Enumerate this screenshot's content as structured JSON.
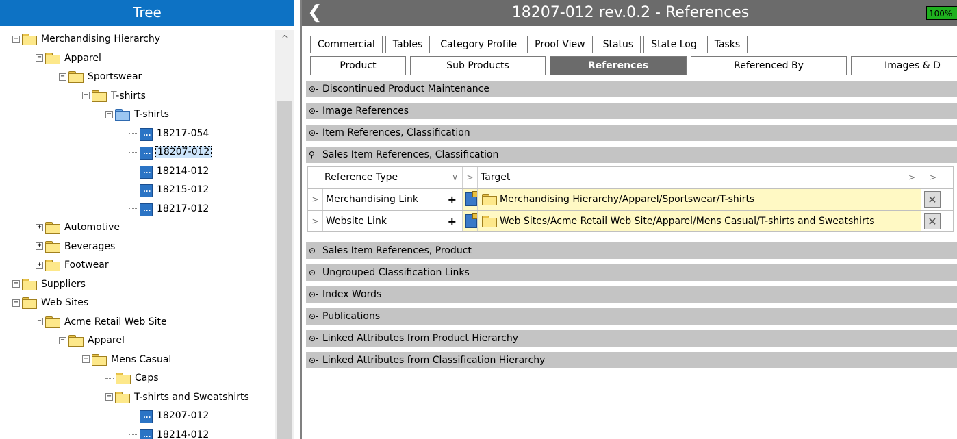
{
  "tree": {
    "header": "Tree",
    "items": [
      {
        "label": "Merchandising Hierarchy",
        "level": 0,
        "expander": "−",
        "icon": "folder"
      },
      {
        "label": "Apparel",
        "level": 1,
        "expander": "−",
        "icon": "folder"
      },
      {
        "label": "Sportswear",
        "level": 2,
        "expander": "−",
        "icon": "folder"
      },
      {
        "label": "T-shirts",
        "level": 3,
        "expander": "−",
        "icon": "folder"
      },
      {
        "label": "T-shirts",
        "level": 4,
        "expander": "−",
        "icon": "folder-blue"
      },
      {
        "label": "18217-054",
        "level": 5,
        "expander": "",
        "icon": "product"
      },
      {
        "label": "18207-012",
        "level": 5,
        "expander": "",
        "icon": "product",
        "selected": true
      },
      {
        "label": "18214-012",
        "level": 5,
        "expander": "",
        "icon": "product"
      },
      {
        "label": "18215-012",
        "level": 5,
        "expander": "",
        "icon": "product"
      },
      {
        "label": "18217-012",
        "level": 5,
        "expander": "",
        "icon": "product"
      },
      {
        "label": "Automotive",
        "level": 1,
        "expander": "+",
        "icon": "folder"
      },
      {
        "label": "Beverages",
        "level": 1,
        "expander": "+",
        "icon": "folder"
      },
      {
        "label": "Footwear",
        "level": 1,
        "expander": "+",
        "icon": "folder"
      },
      {
        "label": "Suppliers",
        "level": 0,
        "expander": "+",
        "icon": "folder"
      },
      {
        "label": "Web Sites",
        "level": 0,
        "expander": "−",
        "icon": "folder"
      },
      {
        "label": "Acme Retail Web Site",
        "level": 1,
        "expander": "−",
        "icon": "folder"
      },
      {
        "label": "Apparel",
        "level": 2,
        "expander": "−",
        "icon": "folder"
      },
      {
        "label": "Mens Casual",
        "level": 3,
        "expander": "−",
        "icon": "folder"
      },
      {
        "label": "Caps",
        "level": 4,
        "expander": "",
        "icon": "folder"
      },
      {
        "label": "T-shirts and Sweatshirts",
        "level": 4,
        "expander": "−",
        "icon": "folder"
      },
      {
        "label": "18207-012",
        "level": 5,
        "expander": "",
        "icon": "product"
      },
      {
        "label": "18214-012",
        "level": 5,
        "expander": "",
        "icon": "product"
      }
    ]
  },
  "editor": {
    "title": "18207-012 rev.0.2 - References",
    "badge": "100%",
    "tabs_row1": [
      "Commercial",
      "Tables",
      "Category Profile",
      "Proof View",
      "Status",
      "State Log",
      "Tasks"
    ],
    "tabs_row2": [
      {
        "label": "Product",
        "active": false
      },
      {
        "label": "Sub Products",
        "active": false
      },
      {
        "label": "References",
        "active": true
      },
      {
        "label": "Referenced By",
        "active": false
      },
      {
        "label": "Images & D",
        "active": false
      }
    ],
    "sections_top": [
      "Discontinued Product Maintenance",
      "Image References",
      "Item References, Classification",
      "Sales Item References, Classification"
    ],
    "grid": {
      "headers": {
        "type": "Reference Type",
        "target": "Target"
      },
      "rows": [
        {
          "type": "Merchandising Link",
          "target": "Merchandising Hierarchy/Apparel/Sportswear/T-shirts"
        },
        {
          "type": "Website Link",
          "target": "Web Sites/Acme Retail Web Site/Apparel/Mens Casual/T-shirts and Sweatshirts"
        }
      ]
    },
    "sections_bottom": [
      "Sales Item References, Product",
      "Ungrouped Classification Links",
      "Index Words",
      "Publications",
      "Linked Attributes from Product Hierarchy",
      "Linked Attributes from Classification Hierarchy"
    ]
  }
}
